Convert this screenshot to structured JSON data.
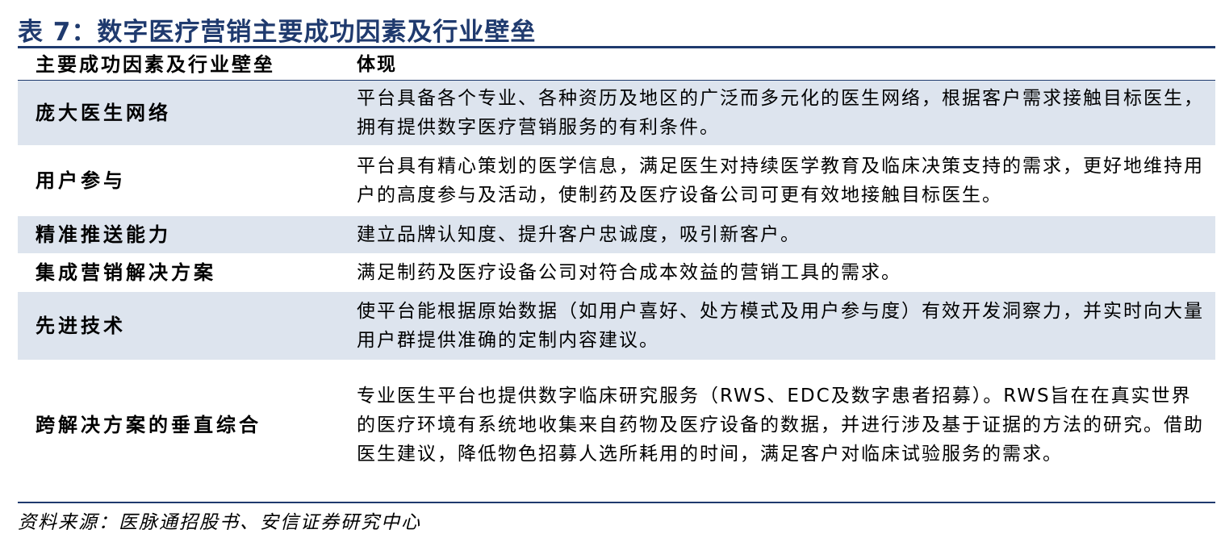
{
  "title": "表 7：数字医疗营销主要成功因素及行业壁垒",
  "table": {
    "headers": [
      "主要成功因素及行业壁垒",
      "体现"
    ],
    "rows": [
      {
        "factor": "庞大医生网络",
        "detail": "平台具备各个专业、各种资历及地区的广泛而多元化的医生网络，根据客户需求接触目标医生，拥有提供数字医疗营销服务的有利条件。"
      },
      {
        "factor": "用户参与",
        "detail": "平台具有精心策划的医学信息，满足医生对持续医学教育及临床决策支持的需求，更好地维持用户的高度参与及活动，使制药及医疗设备公司可更有效地接触目标医生。"
      },
      {
        "factor": "精准推送能力",
        "detail": "建立品牌认知度、提升客户忠诚度，吸引新客户。"
      },
      {
        "factor": "集成营销解决方案",
        "detail": "满足制药及医疗设备公司对符合成本效益的营销工具的需求。"
      },
      {
        "factor": "先进技术",
        "detail": "使平台能根据原始数据（如用户喜好、处方模式及用户参与度）有效开发洞察力，并实时向大量用户群提供准确的定制内容建议。"
      },
      {
        "factor": "跨解决方案的垂直综合",
        "detail": "专业医生平台也提供数字临床研究服务（RWS、EDC及数字患者招募）。RWS旨在在真实世界的医疗环境有系统地收集来自药物及医疗设备的数据，并进行涉及基于证据的方法的研究。借助医生建议，降低物色招募人选所耗用的时间，满足客户对临床试验服务的需求。"
      }
    ]
  },
  "source": "资料来源：医脉通招股书、安信证券研究中心"
}
